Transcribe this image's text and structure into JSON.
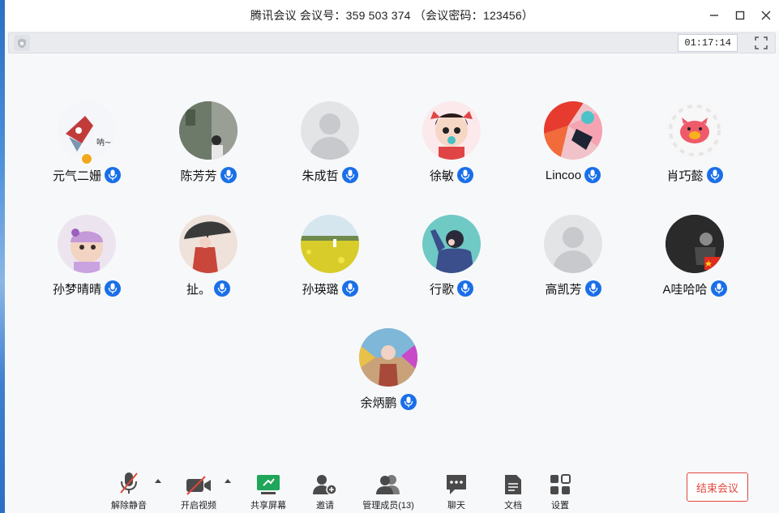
{
  "window": {
    "title": "腾讯会议 会议号：359 503 374 （会议密码：123456）",
    "controls": [
      "minimize-icon",
      "maximize-icon",
      "close-icon"
    ]
  },
  "status_bar": {
    "timer": "01:17:14"
  },
  "members": [
    {
      "name": "元气二姗",
      "avatar": "cartoon-sticker",
      "has_host_badge": true,
      "avatar_text": "呐~"
    },
    {
      "name": "陈芳芳",
      "avatar": "photo-street"
    },
    {
      "name": "朱成哲",
      "avatar": "default-silhouette"
    },
    {
      "name": "徐敏",
      "avatar": "cartoon-girl"
    },
    {
      "name": "Lincoo",
      "avatar": "art-red-splash"
    },
    {
      "name": "肖巧懿",
      "avatar": "pink-pig"
    },
    {
      "name": "孙梦晴晴",
      "avatar": "photo-baby"
    },
    {
      "name": "扯。",
      "avatar": "illustration-umbrella"
    },
    {
      "name": "孙瑛璐",
      "avatar": "photo-flower-field"
    },
    {
      "name": "行歌",
      "avatar": "illustration-boy"
    },
    {
      "name": "高凯芳",
      "avatar": "default-silhouette"
    },
    {
      "name": "A哇哈哈",
      "avatar": "photo-dark-flag"
    },
    {
      "name": "余炳鹏",
      "avatar": "photo-colorful"
    }
  ],
  "bottom_toolbar": {
    "unmute": "解除静音",
    "start_video": "开启视频",
    "share_screen": "共享屏幕",
    "invite": "邀请",
    "manage_members": "管理成员(13)",
    "chat": "聊天",
    "docs": "文档",
    "settings": "设置",
    "end_meeting": "结束会议"
  },
  "colors": {
    "mic_blue": "#1a6fe8",
    "end_red": "#e0463b",
    "share_green": "#1fa65a"
  }
}
